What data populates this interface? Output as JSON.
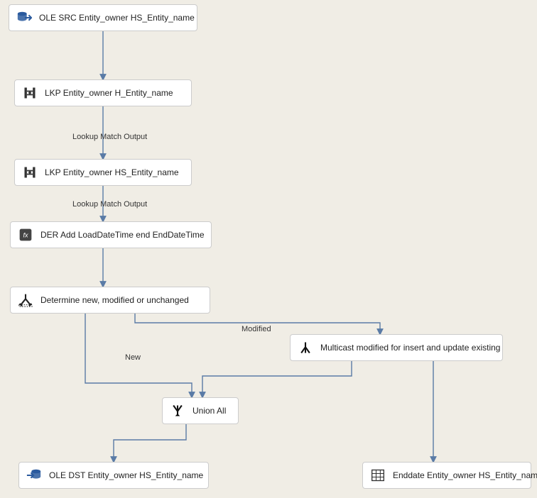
{
  "nodes": {
    "src": {
      "label": "OLE SRC Entity_owner HS_Entity_name",
      "icon": "db-source"
    },
    "lkpH": {
      "label": "LKP Entity_owner H_Entity_name",
      "icon": "lookup"
    },
    "lkpHS": {
      "label": "LKP Entity_owner HS_Entity_name",
      "icon": "lookup"
    },
    "der": {
      "label": "DER Add LoadDateTime end EndDateTime",
      "icon": "derived"
    },
    "split": {
      "label": "Determine new, modified or unchanged",
      "icon": "split"
    },
    "mcast": {
      "label": "Multicast modified for insert and update existing",
      "icon": "multicast"
    },
    "union": {
      "label": "Union All",
      "icon": "union"
    },
    "dst": {
      "label": "OLE DST Entity_owner HS_Entity_name",
      "icon": "db-dest"
    },
    "enddate": {
      "label": "Enddate Entity_owner HS_Entity_name",
      "icon": "table"
    }
  },
  "edge_labels": {
    "lkpH_out": "Lookup Match Output",
    "lkpHS_out": "Lookup Match Output",
    "new": "New",
    "modified": "Modified"
  },
  "colors": {
    "connector": "#5a7ba6",
    "node_border": "#cccccc",
    "bg": "#f0ede5"
  }
}
